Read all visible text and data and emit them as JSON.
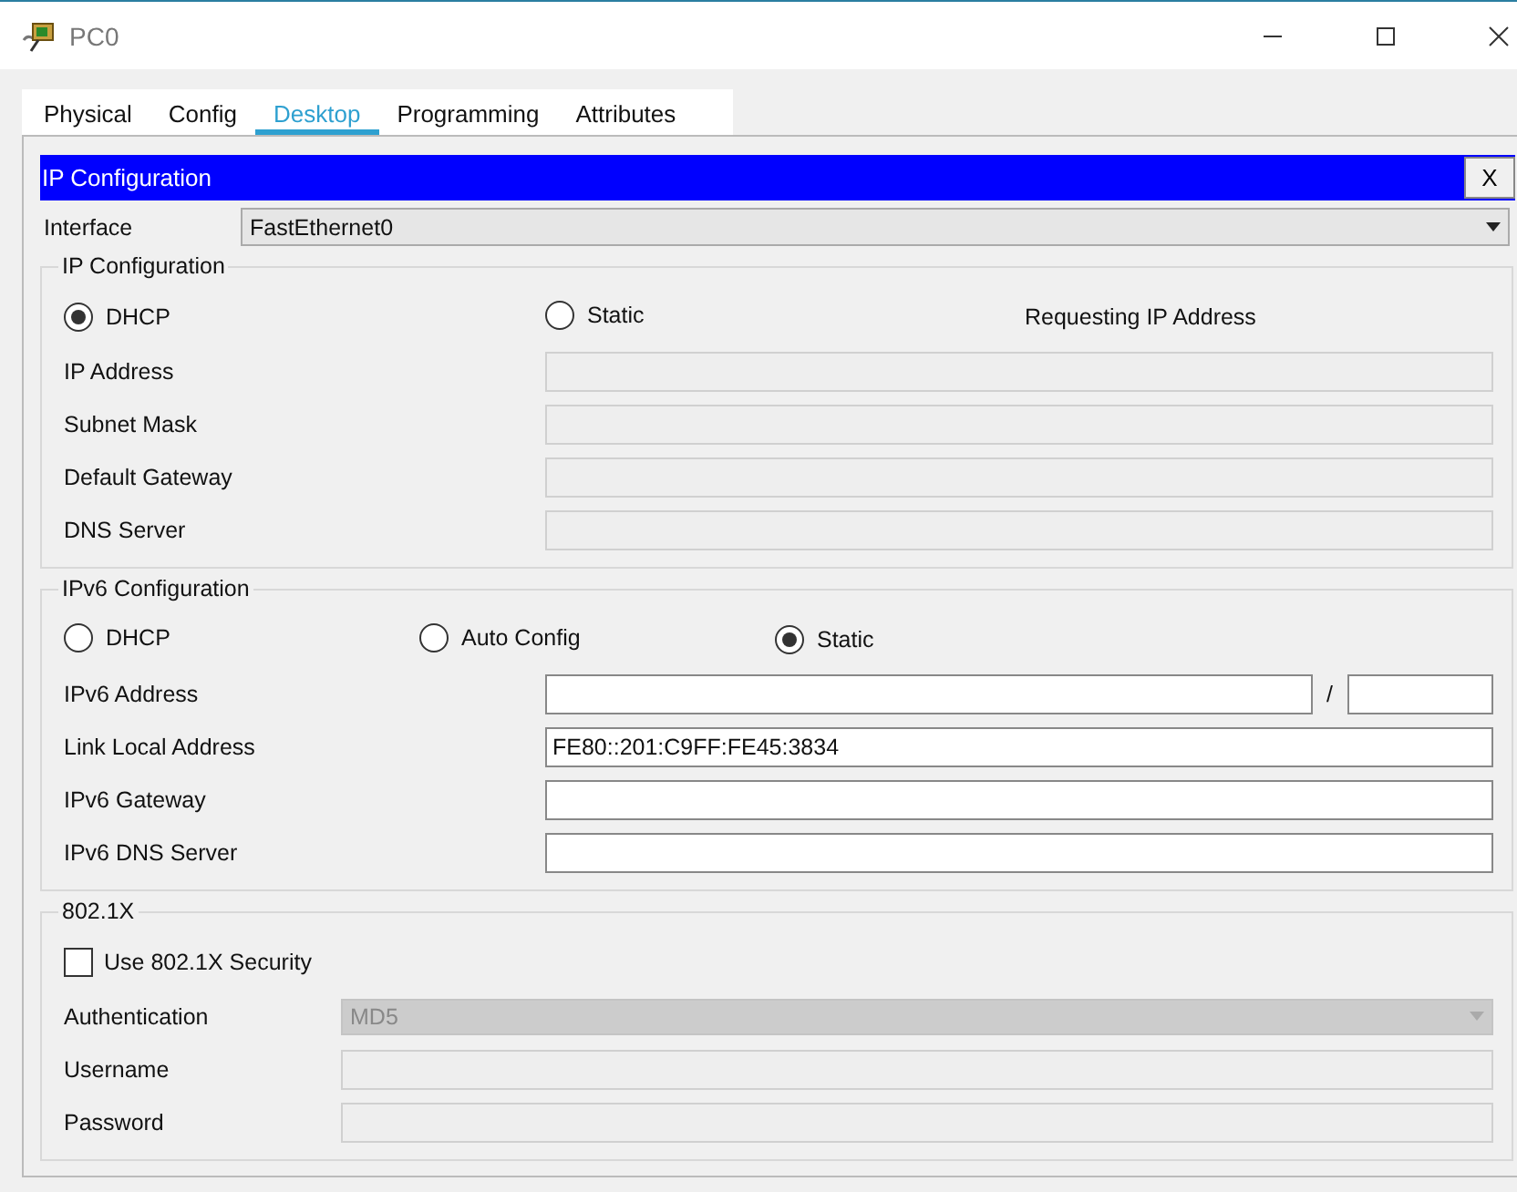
{
  "window": {
    "title": "PC0"
  },
  "tabs": [
    {
      "label": "Physical",
      "selected": false
    },
    {
      "label": "Config",
      "selected": false
    },
    {
      "label": "Desktop",
      "selected": true
    },
    {
      "label": "Programming",
      "selected": false
    },
    {
      "label": "Attributes",
      "selected": false
    }
  ],
  "panel": {
    "title": "IP Configuration",
    "close": "X"
  },
  "interface": {
    "label": "Interface",
    "value": "FastEthernet0"
  },
  "ipv4": {
    "title": "IP Configuration",
    "status": "Requesting IP Address",
    "modes": [
      {
        "label": "DHCP",
        "selected": true
      },
      {
        "label": "Static",
        "selected": false
      }
    ],
    "fields": [
      {
        "label": "IP Address",
        "kind": "text",
        "disabled": true
      },
      {
        "label": "Subnet Mask",
        "kind": "text",
        "disabled": true
      },
      {
        "label": "Default Gateway",
        "kind": "text",
        "disabled": true
      },
      {
        "label": "DNS Server",
        "kind": "text",
        "disabled": true
      }
    ]
  },
  "ipv6": {
    "title": "IPv6 Configuration",
    "modes": [
      {
        "label": "DHCP",
        "selected": false
      },
      {
        "label": "Auto Config",
        "selected": false
      },
      {
        "label": "Static",
        "selected": true
      }
    ],
    "fields": [
      {
        "label": "IPv6 Address",
        "kind": "prefix",
        "separator": "/",
        "disabled": false
      },
      {
        "label": "Link Local Address",
        "kind": "text",
        "value": "FE80::201:C9FF:FE45:3834",
        "disabled": false
      },
      {
        "label": "IPv6 Gateway",
        "kind": "text",
        "disabled": false
      },
      {
        "label": "IPv6 DNS Server",
        "kind": "text",
        "disabled": false
      }
    ]
  },
  "dot1x": {
    "title": "802.1X",
    "checkbox": {
      "label": "Use 802.1X Security",
      "checked": false
    },
    "fields": [
      {
        "label": "Authentication",
        "kind": "select",
        "value": "MD5",
        "disabled": true
      },
      {
        "label": "Username",
        "kind": "text",
        "disabled": true
      },
      {
        "label": "Password",
        "kind": "text",
        "disabled": true
      }
    ]
  }
}
